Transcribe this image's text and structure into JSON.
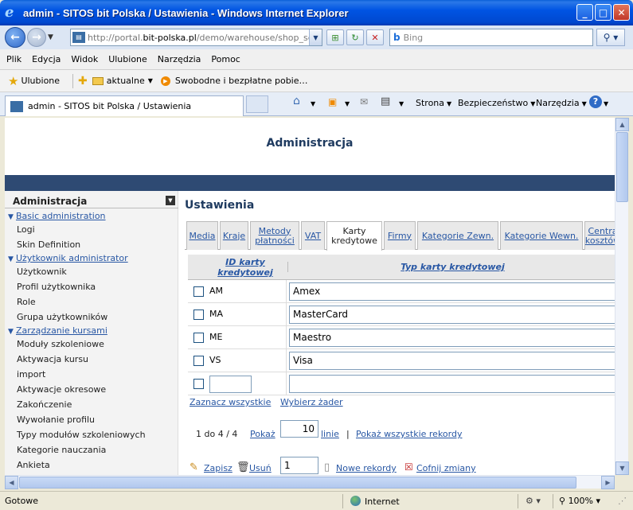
{
  "window": {
    "title": "admin - SITOS bit Polska / Ustawienia - Windows Internet Explorer"
  },
  "address": {
    "url_prefix": "http://portal.",
    "url_domain": "bit-polska.pl",
    "url_rest": "/demo/warehouse/shop_settings",
    "search_placeholder": "Bing"
  },
  "menu": [
    "Plik",
    "Edycja",
    "Widok",
    "Ulubione",
    "Narzędzia",
    "Pomoc"
  ],
  "favorites": {
    "label": "Ulubione",
    "item1": "aktualne",
    "item2": "Swobodne i bezpłatne pobie…"
  },
  "browser_tab": {
    "title": "admin - SITOS bit Polska / Ustawienia"
  },
  "commands": {
    "page": "Strona",
    "safety": "Bezpieczeństwo",
    "tools": "Narzędzia"
  },
  "page": {
    "header_title": "Administracja",
    "title": "Ustawienia"
  },
  "sidebar": {
    "title": "Administracja",
    "groups": [
      {
        "label": "Basic administration",
        "items": [
          "Logi",
          "Skin Definition"
        ]
      },
      {
        "label": "Użytkownik administrator",
        "items": [
          "Użytkownik",
          "Profil użytkownika",
          "Role",
          "Grupa użytkowników"
        ]
      },
      {
        "label": "Zarządzanie kursami",
        "items": [
          "Moduły szkoleniowe",
          "Aktywacja kursu",
          "import",
          "Aktywacje okresowe",
          "Zakończenie",
          "Wywołanie profilu",
          "Typy modułów szkoleniowych",
          "Kategorie nauczania",
          "Ankieta"
        ]
      }
    ]
  },
  "tabs": [
    {
      "label": "Media"
    },
    {
      "label": "Kraje"
    },
    {
      "label": "Metody płatności"
    },
    {
      "label": "VAT"
    },
    {
      "label": "Karty kredytowe"
    },
    {
      "label": "Firmy"
    },
    {
      "label": "Kategorie Zewn."
    },
    {
      "label": "Kategorie Wewn."
    },
    {
      "label": "Centra kosztów"
    }
  ],
  "grid": {
    "col1": "ID karty kredytowej",
    "col2": "Typ karty kredytowej",
    "rows": [
      {
        "id": "AM",
        "name": "Amex"
      },
      {
        "id": "MA",
        "name": "MasterCard"
      },
      {
        "id": "ME",
        "name": "Maestro"
      },
      {
        "id": "VS",
        "name": "Visa"
      }
    ]
  },
  "selection": {
    "select_all": "Zaznacz wszystkie",
    "select_none": "Wybierz żader"
  },
  "pager": {
    "range": "1 do 4 / 4",
    "show": "Pokaż",
    "lines_value": "10",
    "lines": "linie",
    "sep": "|",
    "show_all": "Pokaż wszystkie rekordy"
  },
  "actions": {
    "save": "Zapisz",
    "delete": "Usuń",
    "new_count": "1",
    "new_records": "Nowe rekordy",
    "undo": "Cofnij zmiany"
  },
  "status": {
    "left": "Gotowe",
    "zone": "Internet",
    "zoom": "100%"
  }
}
